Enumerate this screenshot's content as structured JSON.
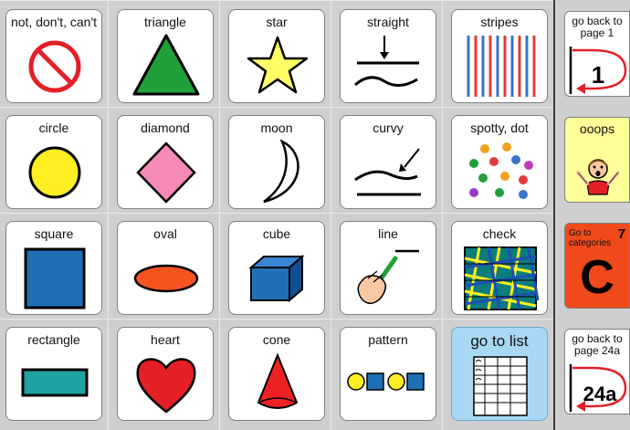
{
  "board": {
    "rows": [
      [
        "not, don't, can't",
        "triangle",
        "star",
        "straight",
        "stripes"
      ],
      [
        "circle",
        "diamond",
        "moon",
        "curvy",
        "spotty,  dot"
      ],
      [
        "square",
        "oval",
        "cube",
        "line",
        "check"
      ],
      [
        "rectangle",
        "heart",
        "cone",
        "pattern",
        "go to list"
      ]
    ]
  },
  "side_panel": {
    "back_page1": {
      "label": "go back to page 1",
      "glyph": "1"
    },
    "ooops": {
      "label": "ooops"
    },
    "categories": {
      "label": "Go to categories",
      "number": "7",
      "glyph": "C"
    },
    "back_page24a": {
      "label": "go back to page 24a",
      "glyph": "24a"
    }
  },
  "colors": {
    "background": "#cfcfcf",
    "go_to_list": "#a9d8f4",
    "ooops": "#ffff99",
    "categories": "#f04a1a"
  }
}
